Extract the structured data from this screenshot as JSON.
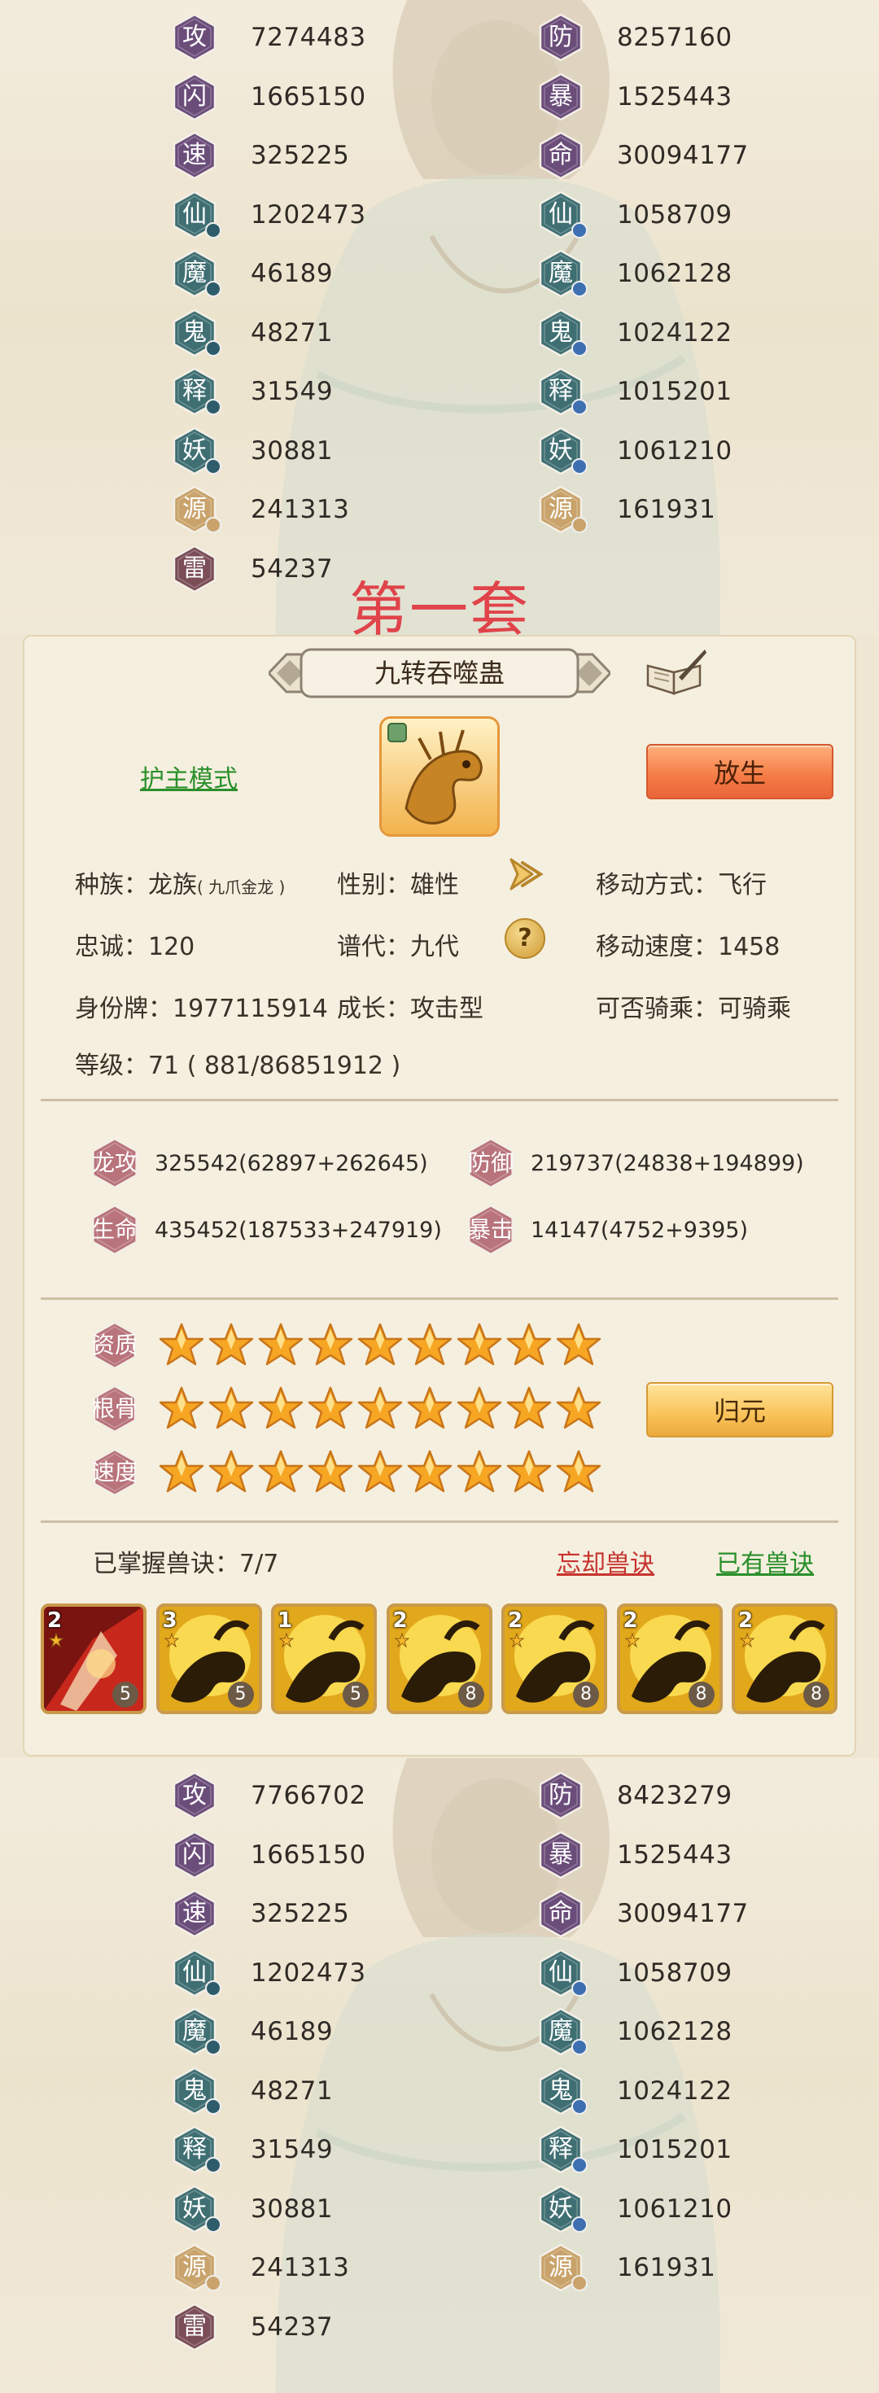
{
  "top_stats": {
    "left": [
      {
        "char": "攻",
        "value": "7274483",
        "color": "#6b4d7a",
        "dot": ""
      },
      {
        "char": "闪",
        "value": "1665150",
        "color": "#6b4d7a",
        "dot": ""
      },
      {
        "char": "速",
        "value": "325225",
        "color": "#6b4d7a",
        "dot": ""
      },
      {
        "char": "仙",
        "value": "1202473",
        "color": "#3f6f73",
        "dot": "d1"
      },
      {
        "char": "魔",
        "value": "46189",
        "color": "#3f6f73",
        "dot": "d1"
      },
      {
        "char": "鬼",
        "value": "48271",
        "color": "#3f6f73",
        "dot": "d1"
      },
      {
        "char": "释",
        "value": "31549",
        "color": "#3f6f73",
        "dot": "d1"
      },
      {
        "char": "妖",
        "value": "30881",
        "color": "#3f6f73",
        "dot": "d1"
      },
      {
        "char": "源",
        "value": "241313",
        "color": "#c9a36b",
        "dot": "d3"
      },
      {
        "char": "雷",
        "value": "54237",
        "color": "#7a4d57",
        "dot": ""
      }
    ],
    "right": [
      {
        "char": "防",
        "value": "8257160",
        "color": "#6b4d7a",
        "dot": ""
      },
      {
        "char": "暴",
        "value": "1525443",
        "color": "#6b4d7a",
        "dot": ""
      },
      {
        "char": "命",
        "value": "30094177",
        "color": "#6b4d7a",
        "dot": ""
      },
      {
        "char": "仙",
        "value": "1058709",
        "color": "#3f6f73",
        "dot": "d2"
      },
      {
        "char": "魔",
        "value": "1062128",
        "color": "#3f6f73",
        "dot": "d2"
      },
      {
        "char": "鬼",
        "value": "1024122",
        "color": "#3f6f73",
        "dot": "d2"
      },
      {
        "char": "释",
        "value": "1015201",
        "color": "#3f6f73",
        "dot": "d2"
      },
      {
        "char": "妖",
        "value": "1061210",
        "color": "#3f6f73",
        "dot": "d2"
      },
      {
        "char": "源",
        "value": "161931",
        "color": "#c9a36b",
        "dot": "d3"
      }
    ]
  },
  "set_title": "第一套",
  "pet": {
    "name": "九转吞噬蛊",
    "guard_mode": "护主模式",
    "release_button": "放生",
    "info": {
      "race_label": "种族：",
      "race_value": "龙族",
      "race_sub": "( 九爪金龙 )",
      "gender": "性别：雄性",
      "move_type": "移动方式：飞行",
      "loyalty": "忠诚：120",
      "generation": "谱代：九代",
      "move_speed": "移动速度：1458",
      "id_tag": "身份牌：1977115914",
      "growth": "成长：攻击型",
      "rideable": "可否骑乘：可骑乘",
      "level": "等级：71 ( 881/86851912 )"
    },
    "help_glyph": "?",
    "attributes": [
      {
        "label": "龙攻",
        "value": "325542(62897+262645)"
      },
      {
        "label": "防御",
        "value": "219737(24838+194899)"
      },
      {
        "label": "生命",
        "value": "435452(187533+247919)"
      },
      {
        "label": "暴击",
        "value": "14147(4752+9395)"
      }
    ],
    "star_rows": [
      {
        "label": "资质",
        "stars": 9
      },
      {
        "label": "根骨",
        "stars": 9
      },
      {
        "label": "速度",
        "stars": 9
      }
    ],
    "return_button": "归元",
    "skills_mastered": "已掌握兽诀：7/7",
    "forget_link": "忘却兽诀",
    "owned_link": "已有兽诀",
    "skills": [
      {
        "level": "2",
        "count": "5",
        "style": "red"
      },
      {
        "level": "3",
        "count": "5",
        "style": "gold"
      },
      {
        "level": "1",
        "count": "5",
        "style": "gold"
      },
      {
        "level": "2",
        "count": "8",
        "style": "gold"
      },
      {
        "level": "2",
        "count": "8",
        "style": "gold"
      },
      {
        "level": "2",
        "count": "8",
        "style": "gold"
      },
      {
        "level": "2",
        "count": "8",
        "style": "gold"
      }
    ]
  },
  "bottom_stats": {
    "left": [
      {
        "char": "攻",
        "value": "7766702",
        "color": "#6b4d7a",
        "dot": ""
      },
      {
        "char": "闪",
        "value": "1665150",
        "color": "#6b4d7a",
        "dot": ""
      },
      {
        "char": "速",
        "value": "325225",
        "color": "#6b4d7a",
        "dot": ""
      },
      {
        "char": "仙",
        "value": "1202473",
        "color": "#3f6f73",
        "dot": "d1"
      },
      {
        "char": "魔",
        "value": "46189",
        "color": "#3f6f73",
        "dot": "d1"
      },
      {
        "char": "鬼",
        "value": "48271",
        "color": "#3f6f73",
        "dot": "d1"
      },
      {
        "char": "释",
        "value": "31549",
        "color": "#3f6f73",
        "dot": "d1"
      },
      {
        "char": "妖",
        "value": "30881",
        "color": "#3f6f73",
        "dot": "d1"
      },
      {
        "char": "源",
        "value": "241313",
        "color": "#c9a36b",
        "dot": "d3"
      },
      {
        "char": "雷",
        "value": "54237",
        "color": "#7a4d57",
        "dot": ""
      }
    ],
    "right": [
      {
        "char": "防",
        "value": "8423279",
        "color": "#6b4d7a",
        "dot": ""
      },
      {
        "char": "暴",
        "value": "1525443",
        "color": "#6b4d7a",
        "dot": ""
      },
      {
        "char": "命",
        "value": "30094177",
        "color": "#6b4d7a",
        "dot": ""
      },
      {
        "char": "仙",
        "value": "1058709",
        "color": "#3f6f73",
        "dot": "d2"
      },
      {
        "char": "魔",
        "value": "1062128",
        "color": "#3f6f73",
        "dot": "d2"
      },
      {
        "char": "鬼",
        "value": "1024122",
        "color": "#3f6f73",
        "dot": "d2"
      },
      {
        "char": "释",
        "value": "1015201",
        "color": "#3f6f73",
        "dot": "d2"
      },
      {
        "char": "妖",
        "value": "1061210",
        "color": "#3f6f73",
        "dot": "d2"
      },
      {
        "char": "源",
        "value": "161931",
        "color": "#c9a36b",
        "dot": "d3"
      }
    ]
  }
}
